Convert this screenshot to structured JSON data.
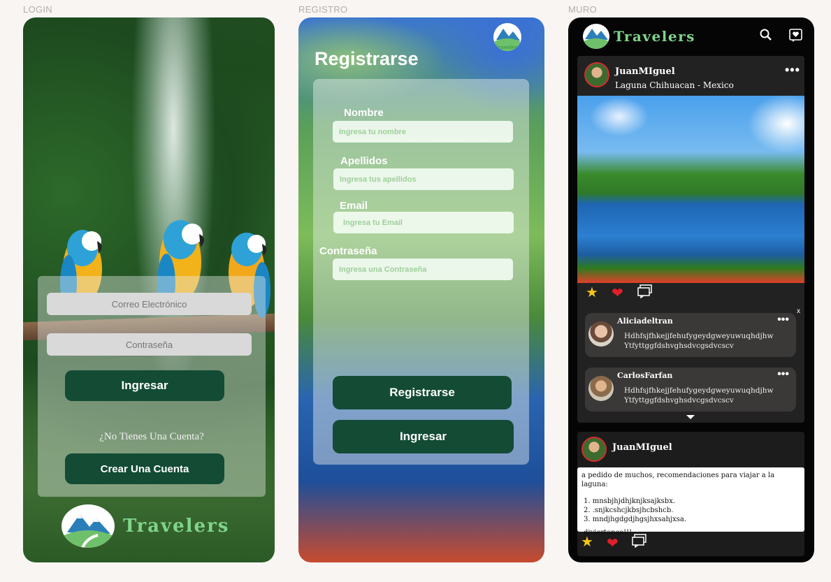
{
  "frames": {
    "login_label": "LOGIN",
    "registro_label": "REGISTRO",
    "muro_label": "MURO"
  },
  "brand": {
    "name": "Travelers",
    "logo_color": "#7fd58a"
  },
  "login": {
    "email_placeholder": "Correo Electrónico",
    "password_placeholder": "Contraseña",
    "login_button": "Ingresar",
    "no_account": "¿No Tienes Una Cuenta?",
    "create_account_button": "Crear Una Cuenta"
  },
  "registro": {
    "title": "Registrarse",
    "fields": {
      "nombre_label": "Nombre",
      "nombre_placeholder": "Ingresa tu nombre",
      "apellidos_label": "Apellidos",
      "apellidos_placeholder": "Ingresa tus apellidos",
      "email_label": "Email",
      "email_placeholder": "Ingresa tu Email",
      "password_label": "Contraseña",
      "password_placeholder": "Ingresa una Contraseña"
    },
    "register_button": "Registrarse",
    "login_button": "Ingresar"
  },
  "muro": {
    "post1": {
      "user": "JuanMIguel",
      "location": "Laguna Chihuacan - Mexico",
      "comments": [
        {
          "user": "Aliciadeltran",
          "line1": "Hdhfsjfhkejjfehufygeydgweyuwuqhdjhw",
          "line2": "Ytfyttggfdshvghsdvcgsdvcscv"
        },
        {
          "user": "CarlosFarfan",
          "line1": "Hdhfsjfhkejjfehufygeydgweyuwuqhdjhw",
          "line2": "Ytfyttggfdshvghsdvcgsdvcscv"
        }
      ],
      "close_label": "x"
    },
    "post2": {
      "user": "JuanMIguel",
      "intro": "a pedido de muchos, recomendaciones para viajar a la laguna:",
      "items": [
        "1. mnsbjhjdhjknjksajksbx.",
        "2. .snjkcshcjkbsjhcbshcb.",
        "3.  mndjhgdgdjhgsjhxsahjxsa."
      ],
      "outro": "diviertance!!!"
    }
  },
  "colors": {
    "button_green": "#134b35",
    "heart": "#e0202a",
    "star": "#f5c518"
  }
}
